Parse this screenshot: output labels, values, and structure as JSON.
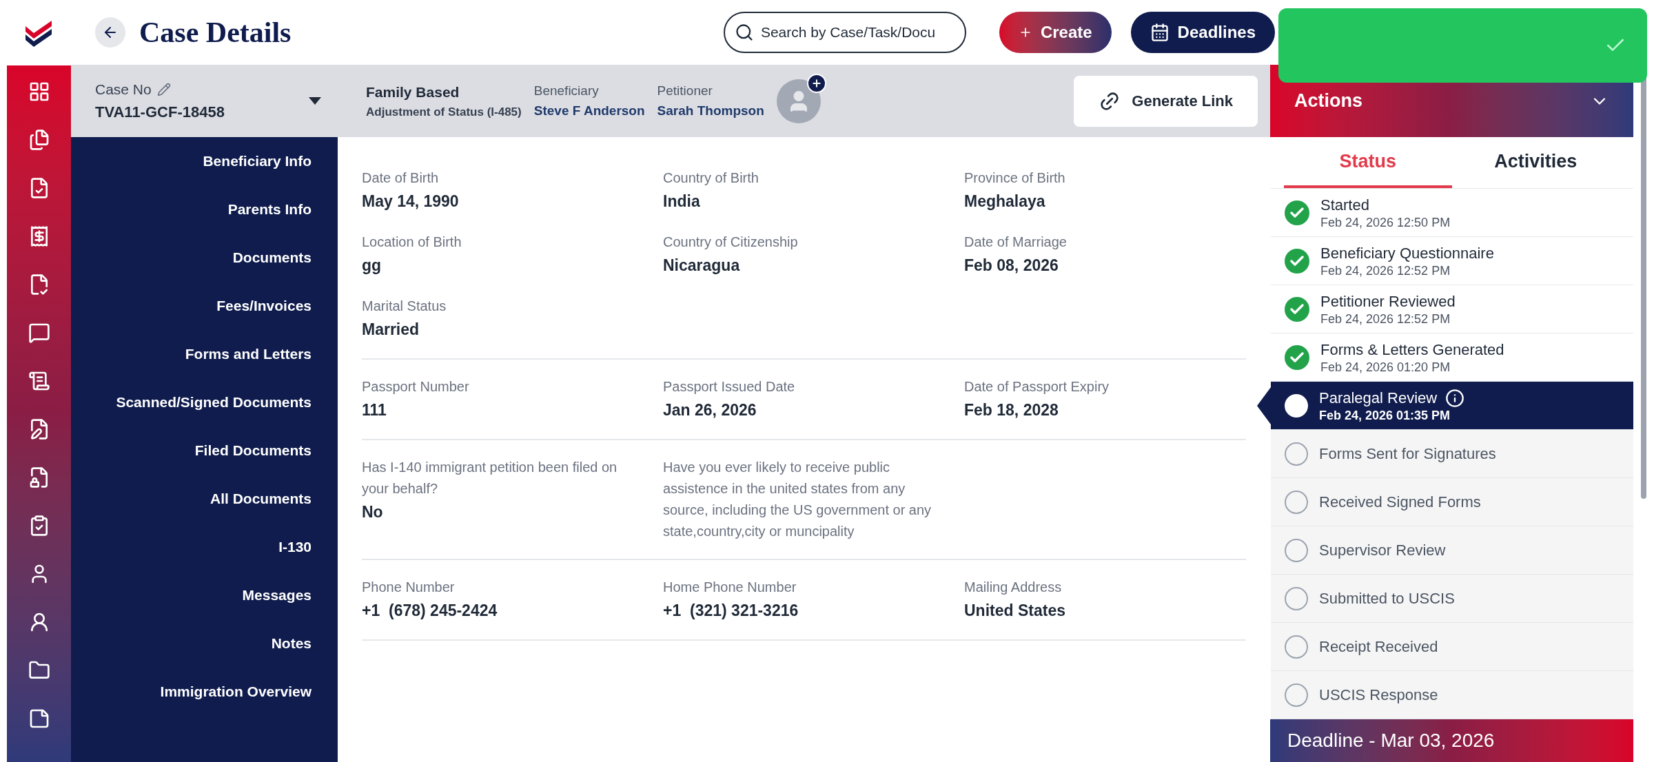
{
  "header": {
    "title": "Case Details",
    "search": {
      "placeholder": "Search by Case/Task/Docu"
    },
    "buttons": [
      {
        "label": "Create",
        "kind": "create"
      },
      {
        "label": "Deadlines",
        "kind": "deadlines"
      }
    ]
  },
  "case_bar": {
    "case_no": {
      "label": "Case No",
      "value": "TVA11-GCF-18458"
    },
    "case_type": {
      "title": "Family Based",
      "subtitle": "Adjustment of Status (I-485)"
    },
    "people": [
      {
        "label": "Beneficiary",
        "value": "Steve F Anderson"
      },
      {
        "label": "Petitioner",
        "value": "Sarah Thompson"
      }
    ],
    "generate_link": "Generate Link"
  },
  "nav": [
    "Beneficiary Info",
    "Parents Info",
    "Documents",
    "Fees/Invoices",
    "Forms and Letters",
    "Scanned/Signed Documents",
    "Filed Documents",
    "All Documents",
    "I-130",
    "Messages",
    "Notes",
    "Immigration Overview"
  ],
  "sections": [
    {
      "fields": [
        {
          "label": "Date of Birth",
          "value": "May 14, 1990"
        },
        {
          "label": "Country of Birth",
          "value": "India"
        },
        {
          "label": "Province of Birth",
          "value": "Meghalaya"
        },
        {
          "label": "Location of Birth",
          "value": "gg"
        },
        {
          "label": "Country of Citizenship",
          "value": "Nicaragua"
        },
        {
          "label": "Date of Marriage",
          "value": "Feb 08, 2026"
        },
        {
          "label": "Marital Status",
          "value": "Married"
        }
      ]
    },
    {
      "fields": [
        {
          "label": "Passport Number",
          "value": "111"
        },
        {
          "label": "Passport Issued Date",
          "value": "Jan 26, 2026"
        },
        {
          "label": "Date of Passport Expiry",
          "value": "Feb 18, 2028"
        }
      ]
    },
    {
      "fields": [
        {
          "label": "Has I-140 immigrant petition been filed on your behalf?",
          "value": "No"
        },
        {
          "label": "Have you ever likely to receive public assistence in the united states from any source, including the US government or any state,country,city or muncipality"
        }
      ]
    },
    {
      "fields": [
        {
          "label": "Phone Number",
          "value": "+1  (678) 245-2424"
        },
        {
          "label": "Home Phone Number",
          "value": "+1  (321) 321-3216"
        },
        {
          "label": "Mailing Address",
          "value": "United States"
        }
      ]
    }
  ],
  "actions": {
    "title": "Actions",
    "expanded": true,
    "tabs": [
      {
        "label": "Status",
        "selected": true
      },
      {
        "label": "Activities",
        "selected": false
      }
    ],
    "statuses": [
      {
        "label": "Started",
        "date": "Feb 24, 2026 12:50 PM",
        "completed": true,
        "selected": false
      },
      {
        "label": "Beneficiary Questionnaire",
        "date": "Feb 24, 2026 12:52 PM",
        "completed": true,
        "selected": false
      },
      {
        "label": "Petitioner Reviewed",
        "date": "Feb 24, 2026 12:52 PM",
        "completed": true,
        "selected": false
      },
      {
        "label": "Forms & Letters Generated",
        "date": "Feb 24, 2026 01:20 PM",
        "completed": true,
        "selected": false
      },
      {
        "label": "Paralegal Review",
        "date": "Feb 24, 2026 01:35 PM",
        "completed": false,
        "selected": true
      },
      {
        "label": "Forms Sent for Signatures",
        "completed": false,
        "selected": false
      },
      {
        "label": "Received Signed Forms",
        "completed": false,
        "selected": false
      },
      {
        "label": "Supervisor Review",
        "completed": false,
        "selected": false
      },
      {
        "label": "Submitted to USCIS",
        "completed": false,
        "selected": false
      },
      {
        "label": "Receipt Received",
        "completed": false,
        "selected": false
      },
      {
        "label": "USCIS Response",
        "completed": false,
        "selected": false
      }
    ],
    "deadline": "Deadline - Mar 03, 2026"
  }
}
